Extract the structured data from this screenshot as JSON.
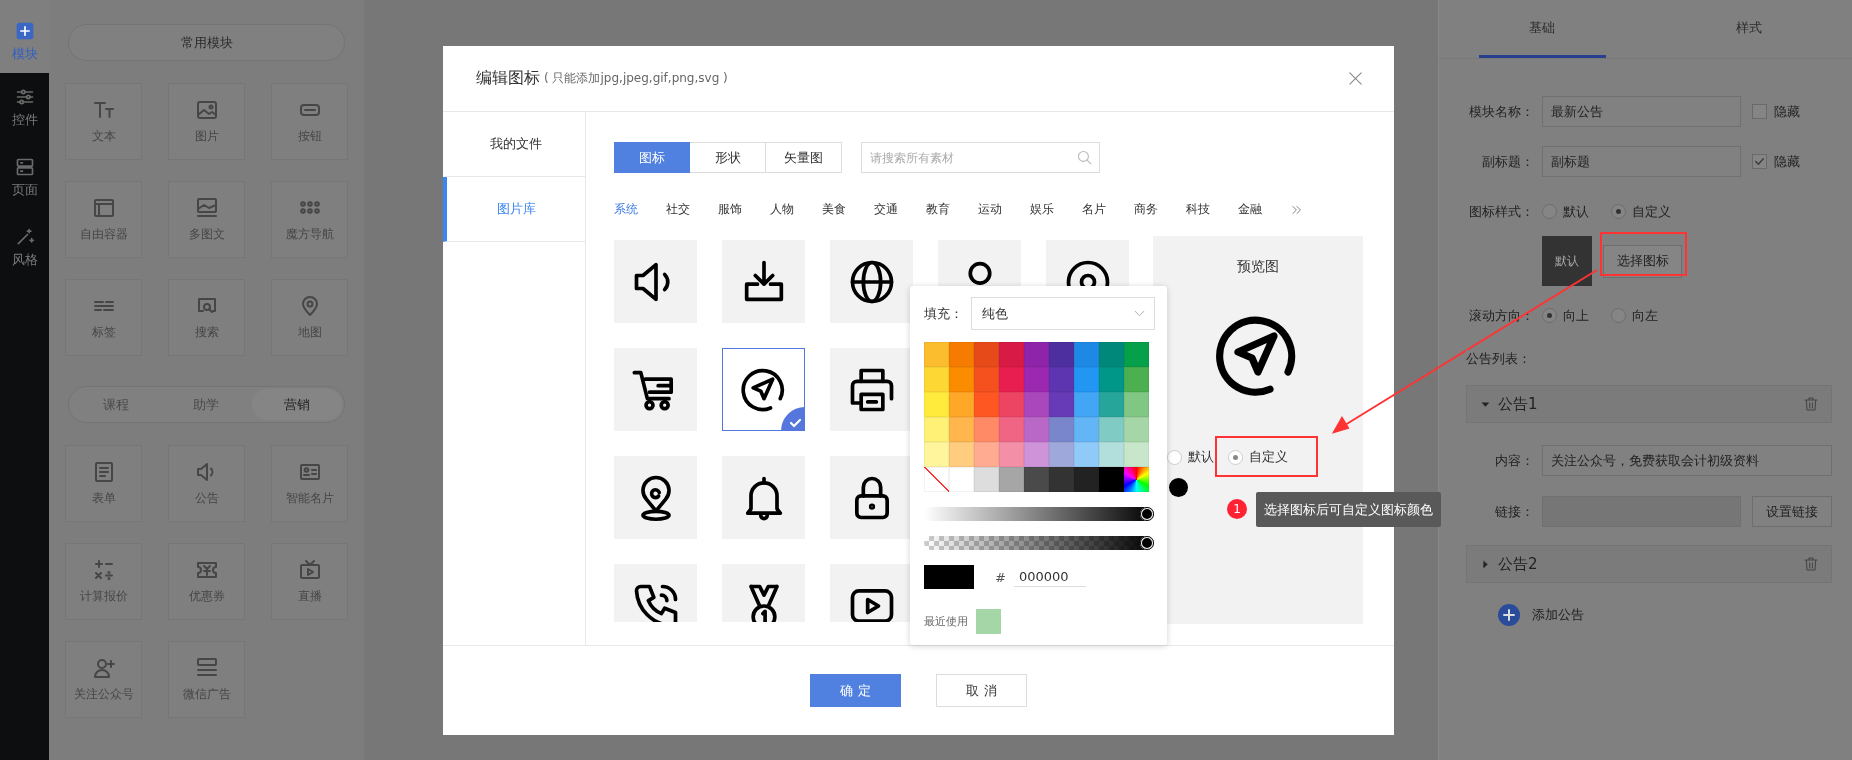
{
  "sidebar": {
    "items": [
      {
        "label": "模块",
        "selected": true
      },
      {
        "label": "控件",
        "selected": false
      },
      {
        "label": "页面",
        "selected": false
      },
      {
        "label": "风格",
        "selected": false
      }
    ]
  },
  "module_panel": {
    "common_title": "常用模块",
    "common_modules": [
      "文本",
      "图片",
      "按钮",
      "自由容器",
      "多图文",
      "魔方导航",
      "标签",
      "搜索",
      "地图"
    ],
    "category_tabs": [
      {
        "label": "课程",
        "selected": false
      },
      {
        "label": "助学",
        "selected": false
      },
      {
        "label": "营销",
        "selected": true
      }
    ],
    "category_modules": [
      "表单",
      "公告",
      "智能名片",
      "计算报价",
      "优惠券",
      "直播",
      "关注公众号",
      "微信广告"
    ]
  },
  "settings_panel": {
    "tabs": [
      {
        "label": "基础",
        "selected": true
      },
      {
        "label": "样式",
        "selected": false
      }
    ],
    "module_name": {
      "label": "模块名称：",
      "value": "最新公告",
      "hide_label": "隐藏",
      "hidden": false
    },
    "subtitle": {
      "label": "副标题：",
      "value": "副标题",
      "hide_label": "隐藏",
      "hidden": true
    },
    "icon_style": {
      "label": "图标样式：",
      "options": [
        {
          "label": "默认",
          "selected": false
        },
        {
          "label": "自定义",
          "selected": true
        }
      ]
    },
    "icon_preview_label": "默认",
    "choose_icon_button": "选择图标",
    "scroll_direction": {
      "label": "滚动方向：",
      "options": [
        {
          "label": "向上",
          "selected": true
        },
        {
          "label": "向左",
          "selected": false
        }
      ]
    },
    "notice_list_label": "公告列表：",
    "notices": [
      {
        "title": "公告1",
        "expanded": true,
        "content_label": "内容：",
        "content": "关注公众号，免费获取会计初级资料",
        "link_label": "链接：",
        "link_button": "设置链接"
      },
      {
        "title": "公告2",
        "expanded": false
      }
    ],
    "add_notice": "添加公告"
  },
  "dialog": {
    "title": "编辑图标",
    "hint": "( 只能添加jpg,jpeg,gif,png,svg )",
    "nav": [
      {
        "label": "我的文件",
        "selected": false
      },
      {
        "label": "图片库",
        "selected": true
      }
    ],
    "type_tabs": [
      {
        "label": "图标",
        "selected": true
      },
      {
        "label": "形状",
        "selected": false
      },
      {
        "label": "矢量图",
        "selected": false
      }
    ],
    "search": {
      "placeholder": "请搜索所有素材"
    },
    "categories": [
      {
        "label": "系统",
        "selected": true
      },
      {
        "label": "社交",
        "selected": false
      },
      {
        "label": "服饰",
        "selected": false
      },
      {
        "label": "人物",
        "selected": false
      },
      {
        "label": "美食",
        "selected": false
      },
      {
        "label": "交通",
        "selected": false
      },
      {
        "label": "教育",
        "selected": false
      },
      {
        "label": "运动",
        "selected": false
      },
      {
        "label": "娱乐",
        "selected": false
      },
      {
        "label": "名片",
        "selected": false
      },
      {
        "label": "商务",
        "selected": false
      },
      {
        "label": "科技",
        "selected": false
      },
      {
        "label": "金融",
        "selected": false
      }
    ],
    "icon_rows": [
      [
        {
          "selected": false
        },
        {
          "selected": false
        },
        {
          "selected": false
        },
        {
          "selected": false
        },
        {
          "selected": false
        }
      ],
      [
        {
          "selected": false
        },
        {
          "selected": true
        },
        {
          "selected": false
        }
      ],
      [
        {
          "selected": false
        },
        {
          "selected": false
        },
        {
          "selected": false
        }
      ],
      [
        {
          "selected": false
        },
        {
          "selected": false
        },
        {
          "selected": false
        }
      ]
    ],
    "preview": {
      "title": "预览图",
      "color_options": [
        {
          "label": "默认",
          "selected": false
        },
        {
          "label": "自定义",
          "selected": true
        }
      ],
      "color": "#000000"
    },
    "color_picker": {
      "fill_label": "填充：",
      "fill_mode": "纯色",
      "palette": [
        [
          {
            "color": "#fbbc2e"
          },
          {
            "color": "#f57c00"
          },
          {
            "color": "#e64a19"
          },
          {
            "color": "#d81b45"
          },
          {
            "color": "#8e24aa"
          },
          {
            "color": "#4e2fa0"
          },
          {
            "color": "#1e88e5"
          },
          {
            "color": "#00897b"
          },
          {
            "color": "#06a04a"
          }
        ],
        [
          {
            "color": "#fdd835"
          },
          {
            "color": "#fb8c00"
          },
          {
            "color": "#f4511e"
          },
          {
            "color": "#e91e50"
          },
          {
            "color": "#9c27b0"
          },
          {
            "color": "#5e35b1"
          },
          {
            "color": "#2196f3"
          },
          {
            "color": "#009688"
          },
          {
            "color": "#4caf50"
          }
        ],
        [
          {
            "color": "#ffeb3b"
          },
          {
            "color": "#ffa726"
          },
          {
            "color": "#ff5722"
          },
          {
            "color": "#ec4462"
          },
          {
            "color": "#ab47bc"
          },
          {
            "color": "#673ab7"
          },
          {
            "color": "#42a5f5"
          },
          {
            "color": "#26a69a"
          },
          {
            "color": "#81c784"
          }
        ],
        [
          {
            "color": "#fff176"
          },
          {
            "color": "#ffb74d"
          },
          {
            "color": "#ff8a65"
          },
          {
            "color": "#f06584"
          },
          {
            "color": "#ba68c8"
          },
          {
            "color": "#7986cb"
          },
          {
            "color": "#64b5f6"
          },
          {
            "color": "#80cbc4"
          },
          {
            "color": "#a5d6a7"
          }
        ],
        [
          {
            "color": "#fff59d"
          },
          {
            "color": "#ffcc80"
          },
          {
            "color": "#ffab91"
          },
          {
            "color": "#f48fa8"
          },
          {
            "color": "#ce93d8"
          },
          {
            "color": "#9fa8da"
          },
          {
            "color": "#90caf9"
          },
          {
            "color": "#b2dfdb"
          },
          {
            "color": "#c8e6c9"
          }
        ],
        [
          {
            "kind": "none"
          },
          {
            "kind": "solid",
            "color": "#ffffff"
          },
          {
            "kind": "solid",
            "color": "#dddddd"
          },
          {
            "kind": "solid",
            "color": "#a6a6a6"
          },
          {
            "kind": "solid",
            "color": "#4a4a4a"
          },
          {
            "kind": "solid",
            "color": "#333333"
          },
          {
            "kind": "solid",
            "color": "#222222"
          },
          {
            "kind": "solid",
            "color": "#000000"
          },
          {
            "kind": "spectrum"
          }
        ]
      ],
      "brightness": {
        "level": 1
      },
      "opacity": {
        "level": 1
      },
      "hash": "#",
      "hex": "000000",
      "recent_label": "最近使用",
      "recent": [
        {
          "color": "#a5d6a7"
        }
      ]
    },
    "buttons": [
      {
        "label": "确 定",
        "kind": "primary"
      },
      {
        "label": "取 消",
        "kind": "secondary"
      }
    ]
  },
  "annotation": {
    "step": "1",
    "tip": "选择图标后可自定义图标颜色"
  }
}
